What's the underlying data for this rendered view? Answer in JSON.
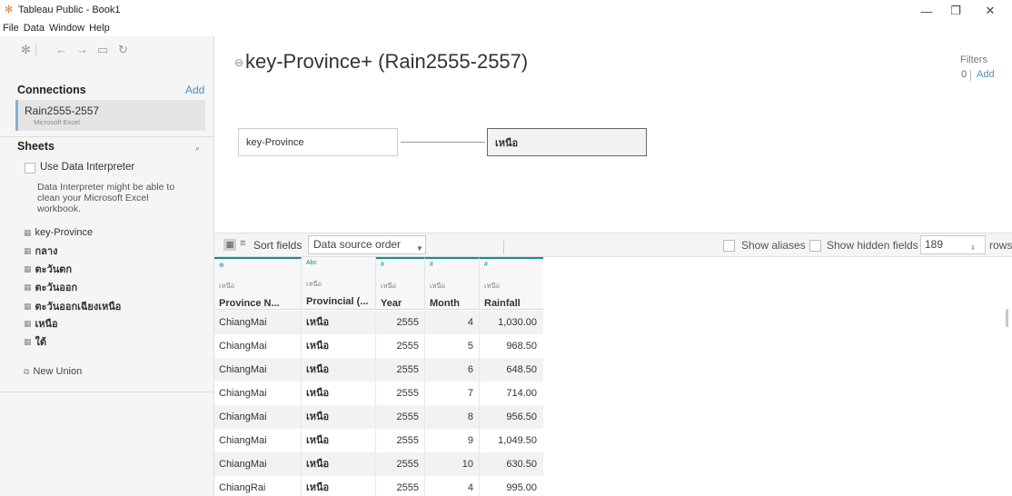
{
  "window": {
    "title": "Tableau Public - Book1",
    "minimize": "—",
    "restore": "❐",
    "close": "✕"
  },
  "menu": [
    "File",
    "Data",
    "Window",
    "Help"
  ],
  "left": {
    "connections_title": "Connections",
    "connections_add": "Add",
    "connection": {
      "name": "Rain2555-2557",
      "type": "Microsoft Excel"
    },
    "sheets_title": "Sheets",
    "interpreter_label": "Use Data Interpreter",
    "interpreter_hint": "Data Interpreter might be able to clean your Microsoft Excel workbook.",
    "sheets": [
      "key-Province",
      "กลาง",
      "ตะวันตก",
      "ตะวันออก",
      "ตะวันออกเฉียงเหนือ",
      "เหนือ",
      "ใต้"
    ],
    "new_union": "New Union"
  },
  "canvas": {
    "title": "key-Province+ (Rain2555-2557)",
    "filters_label": "Filters",
    "filters_count": "0",
    "filters_add": "Add",
    "join_left": "key-Province",
    "join_right": "เหนือ"
  },
  "grid_toolbar": {
    "sort_label": "Sort fields",
    "sort_value": "Data source order",
    "show_aliases": "Show aliases",
    "show_hidden": "Show hidden fields",
    "rows_value": "189",
    "rows_label": "rows"
  },
  "grid": {
    "columns": [
      {
        "type": "⊕",
        "source": "เหนือ",
        "name": "Province N..."
      },
      {
        "type": "Abc",
        "source": "เหนือ",
        "name": "Provincial (..."
      },
      {
        "type": "#",
        "source": "เหนือ",
        "name": "Year"
      },
      {
        "type": "#",
        "source": "เหนือ",
        "name": "Month"
      },
      {
        "type": "#",
        "source": "เหนือ",
        "name": "Rainfall"
      }
    ],
    "rows": [
      [
        "ChiangMai",
        "เหนือ",
        "2555",
        "4",
        "1,030.00"
      ],
      [
        "ChiangMai",
        "เหนือ",
        "2555",
        "5",
        "968.50"
      ],
      [
        "ChiangMai",
        "เหนือ",
        "2555",
        "6",
        "648.50"
      ],
      [
        "ChiangMai",
        "เหนือ",
        "2555",
        "7",
        "714.00"
      ],
      [
        "ChiangMai",
        "เหนือ",
        "2555",
        "8",
        "956.50"
      ],
      [
        "ChiangMai",
        "เหนือ",
        "2555",
        "9",
        "1,049.50"
      ],
      [
        "ChiangMai",
        "เหนือ",
        "2555",
        "10",
        "630.50"
      ],
      [
        "ChiangRai",
        "เหนือ",
        "2555",
        "4",
        "995.00"
      ]
    ]
  }
}
